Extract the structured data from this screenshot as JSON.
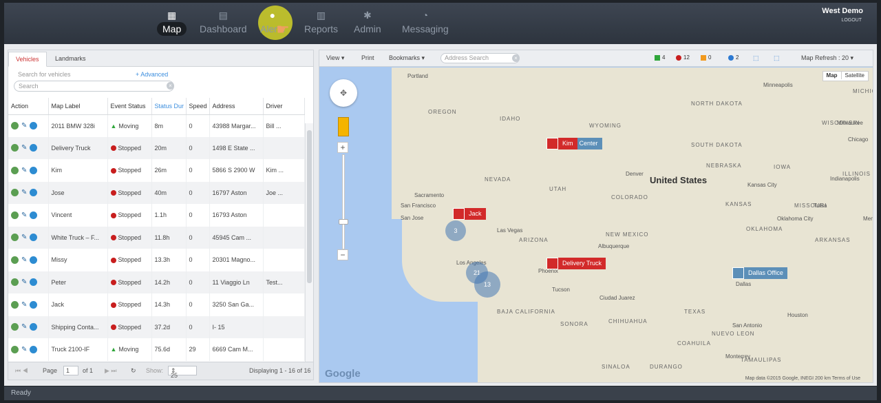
{
  "nav": {
    "items": [
      {
        "label": "Map",
        "icon": "map-icon"
      },
      {
        "label": "Dashboard",
        "icon": "dashboard-icon"
      },
      {
        "label": "Alerts",
        "icon": "bell-icon"
      },
      {
        "label": "Reports",
        "icon": "bar-chart-icon"
      },
      {
        "label": "Admin",
        "icon": "gear-icon"
      },
      {
        "label": "Messaging",
        "icon": "chat-icon"
      }
    ],
    "user": "West Demo",
    "logout": "LOGOUT"
  },
  "left_panel": {
    "tabs": [
      "Vehicles",
      "Landmarks"
    ],
    "search_label": "Search for vehicles",
    "advanced": "+ Advanced",
    "search_placeholder": "Search",
    "columns": [
      "Action",
      "Map Label",
      "Event Status",
      "Status Dur",
      "Speed",
      "Address",
      "Driver"
    ],
    "rows": [
      {
        "label": "2011 BMW 328i",
        "status": "Moving",
        "dur": "8m",
        "speed": "0",
        "address": "43988 Margar...",
        "driver": "Bill ..."
      },
      {
        "label": "Delivery Truck",
        "status": "Stopped",
        "dur": "20m",
        "speed": "0",
        "address": "1498 E State ...",
        "driver": ""
      },
      {
        "label": "Kim",
        "status": "Stopped",
        "dur": "26m",
        "speed": "0",
        "address": "5866 S 2900 W",
        "driver": "Kim ..."
      },
      {
        "label": "Jose",
        "status": "Stopped",
        "dur": "40m",
        "speed": "0",
        "address": "16797 Aston",
        "driver": "Joe ..."
      },
      {
        "label": "Vincent",
        "status": "Stopped",
        "dur": "1.1h",
        "speed": "0",
        "address": "16793 Aston",
        "driver": ""
      },
      {
        "label": "White Truck – F...",
        "status": "Stopped",
        "dur": "11.8h",
        "speed": "0",
        "address": "45945 Cam ...",
        "driver": ""
      },
      {
        "label": "Missy",
        "status": "Stopped",
        "dur": "13.3h",
        "speed": "0",
        "address": "20301 Magno...",
        "driver": ""
      },
      {
        "label": "Peter",
        "status": "Stopped",
        "dur": "14.2h",
        "speed": "0",
        "address": "11 Viaggio Ln",
        "driver": "Test..."
      },
      {
        "label": "Jack",
        "status": "Stopped",
        "dur": "14.3h",
        "speed": "0",
        "address": "3250 San Ga...",
        "driver": ""
      },
      {
        "label": "Shipping Conta...",
        "status": "Stopped",
        "dur": "37.2d",
        "speed": "0",
        "address": "I- 15",
        "driver": ""
      },
      {
        "label": "Truck 2100-IF",
        "status": "Moving",
        "dur": "75.6d",
        "speed": "29",
        "address": "6669 Cam M...",
        "driver": ""
      }
    ],
    "pager": {
      "page_label": "Page",
      "page_value": "1",
      "of": "of 1",
      "show_label": "Show:",
      "show_value": "25",
      "displaying": "Displaying 1 - 16 of 16"
    }
  },
  "map": {
    "toolbar": {
      "view": "View",
      "print": "Print",
      "bookmarks": "Bookmarks",
      "address_placeholder": "Address Search",
      "refresh": "Map Refresh : 20"
    },
    "legend": [
      {
        "count": "4",
        "color": "#2fa63a",
        "shape": "arrow"
      },
      {
        "count": "12",
        "color": "#c81e1e",
        "shape": "dot"
      },
      {
        "count": "0",
        "color": "#f29a1e",
        "shape": "triangle"
      },
      {
        "count": "2",
        "color": "#2d7ad2",
        "shape": "dot"
      }
    ],
    "map_types": [
      "Map",
      "Satellite"
    ],
    "labels": {
      "cities": [
        "Portland",
        "Minneapolis",
        "Chicago",
        "Milwaukee",
        "Denver",
        "Kansas City",
        "Indianapolis",
        "Sacramento",
        "San Francisco",
        "San Jose",
        "Las Vegas",
        "Los Angeles",
        "Phoenix",
        "Albuquerque",
        "Tucson",
        "Ciudad Juarez",
        "Dallas",
        "Houston",
        "San Antonio",
        "Monterrey",
        "Tulsa",
        "Oklahoma City",
        "Memphis"
      ],
      "states": [
        "OREGON",
        "IDAHO",
        "WYOMING",
        "NEVADA",
        "UTAH",
        "COLORADO",
        "ARIZONA",
        "NEW MEXICO",
        "NORTH DAKOTA",
        "SOUTH DAKOTA",
        "NEBRASKA",
        "KANSAS",
        "IOWA",
        "MISSOURI",
        "ILLINOIS",
        "WISCONSIN",
        "OKLAHOMA",
        "TEXAS",
        "ARKANSAS",
        "SONORA",
        "CHIHUAHUA",
        "COAHUILA",
        "DURANGO",
        "SINALOA",
        "BAJA CALIFORNIA",
        "NUEVO LEON",
        "TAMAULIPAS",
        "MICHIGAN"
      ],
      "country": "United States"
    },
    "markers": [
      "Kim",
      "Jack",
      "Delivery Truck",
      "Dallas Office",
      "ping Center"
    ],
    "clusters": [
      "3",
      "21",
      "13"
    ],
    "attribution": "Map data ©2015 Google, INEGI   200 km   Terms of Use",
    "google": "Google"
  },
  "status_bar": "Ready"
}
